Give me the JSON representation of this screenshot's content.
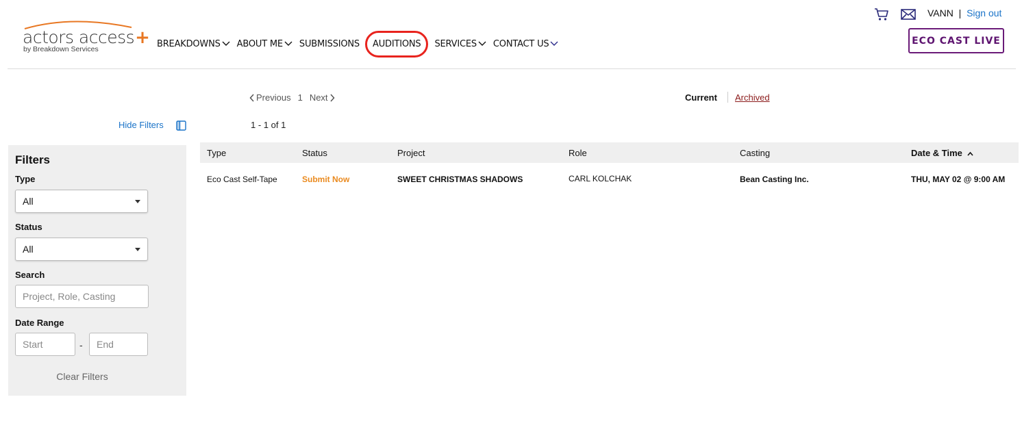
{
  "brand": {
    "name": "actors access",
    "plus": "+",
    "subtitle": "by Breakdown Services"
  },
  "nav": {
    "items": [
      {
        "label": "BREAKDOWNS",
        "dropdown": true
      },
      {
        "label": "ABOUT ME",
        "dropdown": true
      },
      {
        "label": "SUBMISSIONS",
        "dropdown": false
      },
      {
        "label": "AUDITIONS",
        "dropdown": false,
        "highlighted": true
      },
      {
        "label": "SERVICES",
        "dropdown": true
      },
      {
        "label": "CONTACT US",
        "dropdown": true
      }
    ]
  },
  "header": {
    "user": "VANN",
    "separator": "|",
    "sign_out": "Sign out",
    "eco_cast_live": "ECO CAST LIVE",
    "icons": [
      "cart-icon",
      "mail-icon"
    ]
  },
  "pager": {
    "previous": "Previous",
    "page": "1",
    "next": "Next"
  },
  "tabs": {
    "current": "Current",
    "archived": "Archived"
  },
  "toolbar": {
    "hide_filters": "Hide Filters",
    "count": "1 - 1 of 1"
  },
  "filters": {
    "title": "Filters",
    "type_label": "Type",
    "type_value": "All",
    "status_label": "Status",
    "status_value": "All",
    "search_label": "Search",
    "search_placeholder": "Project, Role, Casting",
    "date_label": "Date Range",
    "start_placeholder": "Start",
    "dash": "-",
    "end_placeholder": "End",
    "clear": "Clear Filters"
  },
  "table": {
    "columns": [
      "Type",
      "Status",
      "Project",
      "Role",
      "Casting",
      "Date & Time"
    ],
    "sorted_column": "Date & Time",
    "rows": [
      {
        "type": "Eco Cast Self-Tape",
        "status": "Submit Now",
        "project": "SWEET CHRISTMAS SHADOWS",
        "role": "CARL KOLCHAK",
        "casting": "Bean Casting Inc.",
        "datetime": "THU, MAY 02 @ 9:00 AM"
      }
    ]
  },
  "colors": {
    "accent_orange": "#e87722",
    "link_blue": "#1a73c8",
    "eco_purple": "#6a1a78",
    "highlight_red": "#e8231d",
    "status_orange": "#ea8a1f"
  }
}
